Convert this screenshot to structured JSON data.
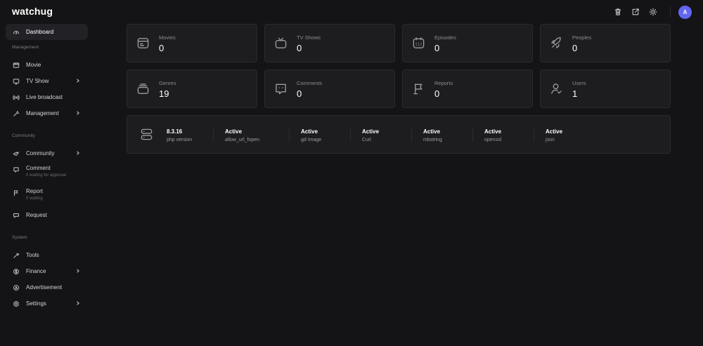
{
  "app": {
    "logo": "watchug",
    "avatar_initial": "A",
    "avatar_color": "#6366f1"
  },
  "topbar": {
    "icons": [
      "trash-icon",
      "external-link-icon",
      "sun-icon"
    ]
  },
  "sidebar": {
    "dashboard": "Dashboard",
    "sections": {
      "management": "Management",
      "community": "Community",
      "system": "System"
    },
    "items": {
      "movie": "Movie",
      "tv_show": "TV Show",
      "live_broadcast": "Live broadcast",
      "management": "Management",
      "community": "Community",
      "comment": "Comment",
      "comment_sub": "0 waiting for approval",
      "report": "Report",
      "report_sub": "0 waiting",
      "request": "Request",
      "tools": "Tools",
      "finance": "Finance",
      "advertisement": "Advertisement",
      "settings": "Settings"
    }
  },
  "stats": [
    {
      "label": "Movies",
      "value": "0",
      "icon": "film-icon"
    },
    {
      "label": "TV Shows",
      "value": "0",
      "icon": "tv-icon"
    },
    {
      "label": "Episodes",
      "value": "0",
      "icon": "calendar-icon"
    },
    {
      "label": "Peoples",
      "value": "0",
      "icon": "rocket-icon"
    },
    {
      "label": "Genres",
      "value": "19",
      "icon": "layers-icon"
    },
    {
      "label": "Comments",
      "value": "0",
      "icon": "comment-icon"
    },
    {
      "label": "Reports",
      "value": "0",
      "icon": "flag-icon"
    },
    {
      "label": "Users",
      "value": "1",
      "icon": "user-icon"
    }
  ],
  "system_status": [
    {
      "title": "8.3.16",
      "subtitle": "php version"
    },
    {
      "title": "Active",
      "subtitle": "allow_url_fopen"
    },
    {
      "title": "Active",
      "subtitle": "gd Image"
    },
    {
      "title": "Active",
      "subtitle": "Curl"
    },
    {
      "title": "Active",
      "subtitle": "mbstring"
    },
    {
      "title": "Active",
      "subtitle": "openssl"
    },
    {
      "title": "Active",
      "subtitle": "json"
    }
  ]
}
